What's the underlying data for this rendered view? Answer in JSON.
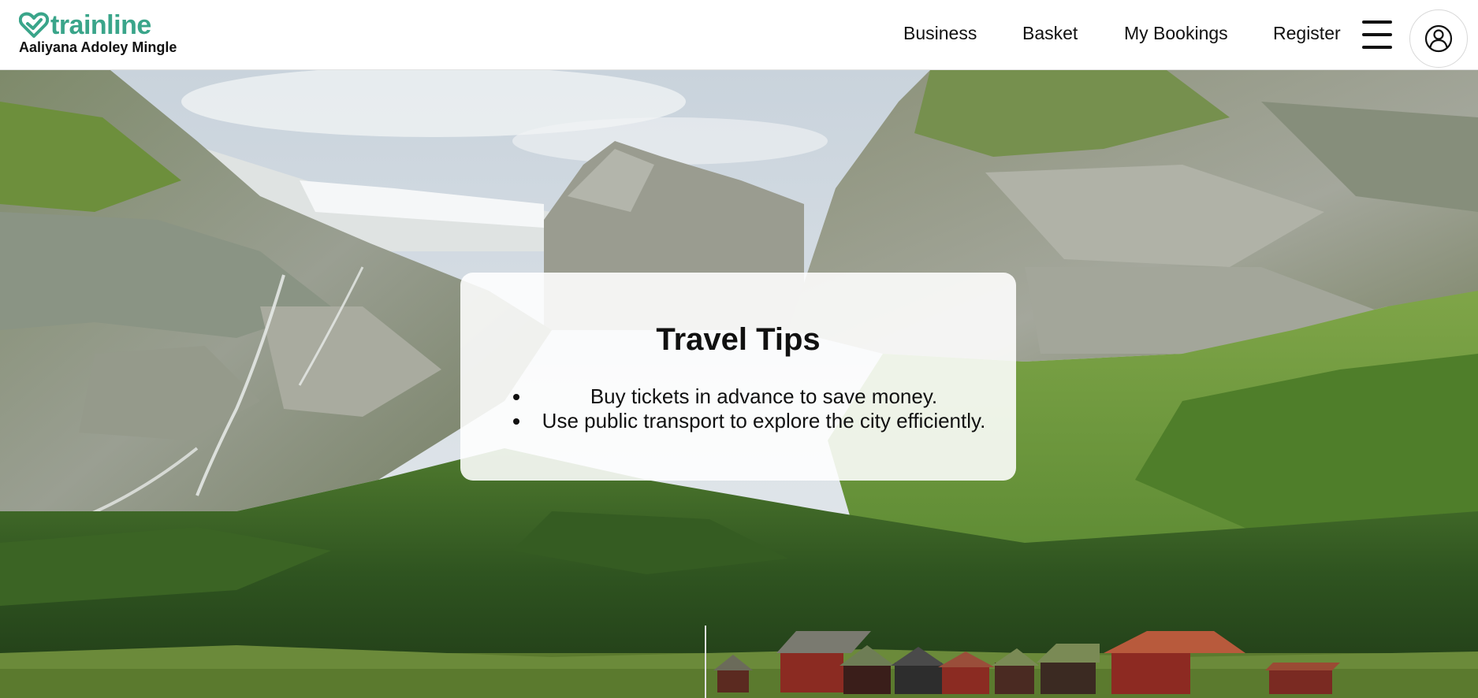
{
  "header": {
    "logo_text": "trainline",
    "username": "Aaliyana Adoley Mingle",
    "nav": {
      "business": "Business",
      "basket": "Basket",
      "my_bookings": "My Bookings",
      "register": "Register"
    },
    "menu_icon": "hamburger-menu-icon",
    "account_icon": "user-account-icon"
  },
  "hero": {
    "image": "mountain-valley-landscape"
  },
  "tips": {
    "title": "Travel Tips",
    "items": [
      "Buy tickets in advance to save money.",
      "Use public transport to explore the city efficiently."
    ]
  },
  "colors": {
    "brand": "#3aa58a",
    "text": "#111111",
    "card_bg": "#f7f7f5"
  }
}
